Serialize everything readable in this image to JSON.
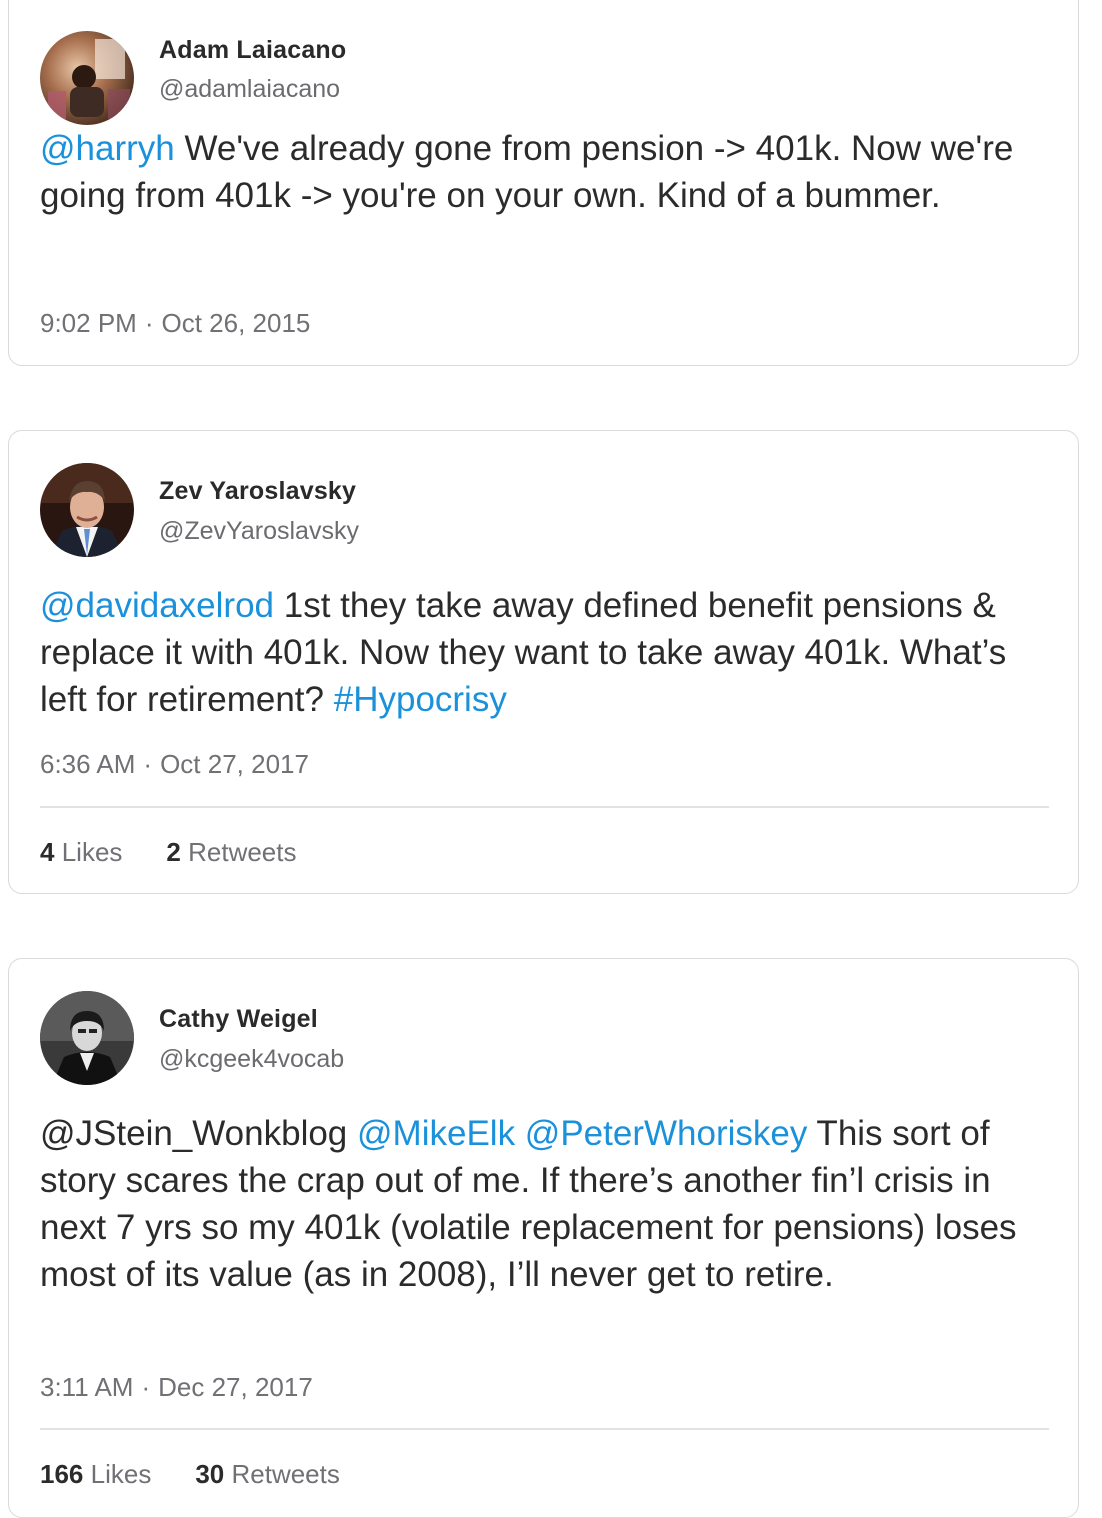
{
  "tweets": [
    {
      "name": "Adam Laiacano",
      "handle": "@adamlaiacano",
      "mention": "@harryh",
      "text": " We've already gone from pension -> 401k. Now we're going from 401k -> you're on your own. Kind of a bummer.",
      "time": "9:02 PM",
      "date": "Oct 26, 2015"
    },
    {
      "name": "Zev Yaroslavsky",
      "handle": "@ZevYaroslavsky",
      "mention": "@davidaxelrod",
      "text": " 1st they take away defined benefit pensions & replace it with 401k. Now they want to take away 401k. What’s left for retirement? ",
      "hashtag": "#Hypocrisy",
      "time": "6:36 AM",
      "date": "Oct 27, 2017",
      "likes_count": "4",
      "likes_label": "Likes",
      "retweets_count": "2",
      "retweets_label": "Retweets"
    },
    {
      "name": "Cathy Weigel",
      "handle": "@kcgeek4vocab",
      "mention_plain": "@JStein_Wonkblog",
      "mention_2": "@MikeElk",
      "mention_3": "@PeterWhoriskey",
      "text": " This sort of story scares the crap out of me. If there’s another fin’l crisis in next 7 yrs so my 401k (volatile replacement for pensions) loses most of its value (as in 2008), I’ll never get to retire.",
      "time": "3:11 AM",
      "date": "Dec 27, 2017",
      "likes_count": "166",
      "likes_label": "Likes",
      "retweets_count": "30",
      "retweets_label": "Retweets"
    }
  ],
  "colors": {
    "link": "#1a91da",
    "text": "#2b2b2b",
    "secondary": "#707075",
    "border": "#d9d9de"
  },
  "icons": {
    "separator": "·"
  }
}
